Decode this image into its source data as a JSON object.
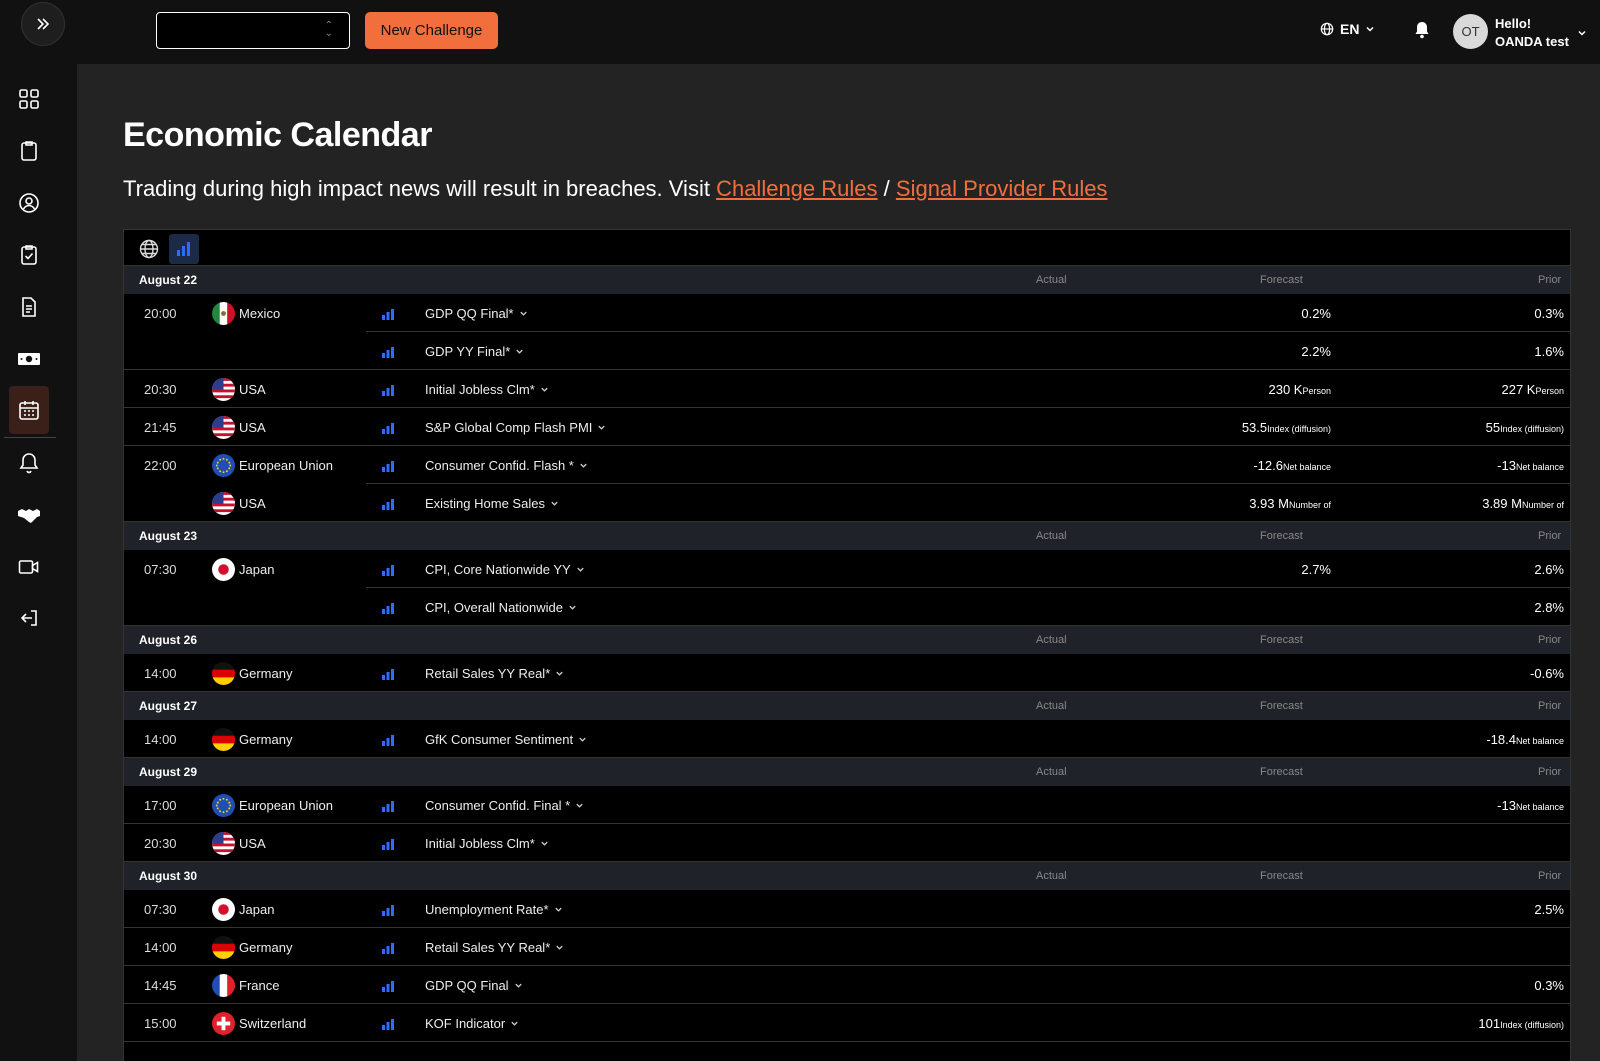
{
  "topbar": {
    "new_challenge_label": "New Challenge",
    "language": "EN",
    "avatar_initials": "OT",
    "greeting": "Hello!",
    "user_name": "OANDA test"
  },
  "page": {
    "title": "Economic Calendar",
    "notice_text": "Trading during high impact news will result in breaches. Visit",
    "link_challenge_rules": "Challenge Rules",
    "separator": "/",
    "link_signal_rules": "Signal Provider Rules"
  },
  "columns": {
    "actual": "Actual",
    "forecast": "Forecast",
    "prior": "Prior"
  },
  "colors": {
    "accent": "#f26f3d",
    "impact": "#2f6bff"
  },
  "days": [
    {
      "date": "August 22",
      "events": [
        {
          "time": "20:00",
          "country": "Mexico",
          "flag": "mx",
          "event": "GDP QQ Final*",
          "forecast": "0.2%",
          "forecast_unit": "",
          "prior": "0.3%",
          "prior_unit": ""
        },
        {
          "time": "",
          "country": "",
          "flag": "",
          "event": "GDP YY Final*",
          "forecast": "2.2%",
          "forecast_unit": "",
          "prior": "1.6%",
          "prior_unit": ""
        },
        {
          "time": "20:30",
          "country": "USA",
          "flag": "us",
          "event": "Initial Jobless Clm*",
          "forecast": "230 K",
          "forecast_unit": "Person",
          "prior": "227 K",
          "prior_unit": "Person"
        },
        {
          "time": "21:45",
          "country": "USA",
          "flag": "us",
          "event": "S&P Global Comp Flash PMI",
          "forecast": "53.5",
          "forecast_unit": "Index (diffusion)",
          "prior": "55",
          "prior_unit": "Index (diffusion)"
        },
        {
          "time": "22:00",
          "country": "European Union",
          "flag": "eu",
          "event": "Consumer Confid. Flash *",
          "forecast": "-12.6",
          "forecast_unit": "Net balance",
          "prior": "-13",
          "prior_unit": "Net balance"
        },
        {
          "time": "",
          "country": "USA",
          "flag": "us",
          "event": "Existing Home Sales",
          "forecast": "3.93 M",
          "forecast_unit": "Number of",
          "prior": "3.89 M",
          "prior_unit": "Number of"
        }
      ]
    },
    {
      "date": "August 23",
      "events": [
        {
          "time": "07:30",
          "country": "Japan",
          "flag": "jp",
          "event": "CPI, Core Nationwide YY",
          "forecast": "2.7%",
          "forecast_unit": "",
          "prior": "2.6%",
          "prior_unit": ""
        },
        {
          "time": "",
          "country": "",
          "flag": "",
          "event": "CPI, Overall Nationwide",
          "forecast": "",
          "forecast_unit": "",
          "prior": "2.8%",
          "prior_unit": ""
        }
      ]
    },
    {
      "date": "August 26",
      "events": [
        {
          "time": "14:00",
          "country": "Germany",
          "flag": "de",
          "event": "Retail Sales YY Real*",
          "forecast": "",
          "forecast_unit": "",
          "prior": "-0.6%",
          "prior_unit": ""
        }
      ]
    },
    {
      "date": "August 27",
      "events": [
        {
          "time": "14:00",
          "country": "Germany",
          "flag": "de",
          "event": "GfK Consumer Sentiment",
          "forecast": "",
          "forecast_unit": "",
          "prior": "-18.4",
          "prior_unit": "Net balance"
        }
      ]
    },
    {
      "date": "August 29",
      "events": [
        {
          "time": "17:00",
          "country": "European Union",
          "flag": "eu",
          "event": "Consumer Confid. Final *",
          "forecast": "",
          "forecast_unit": "",
          "prior": "-13",
          "prior_unit": "Net balance"
        },
        {
          "time": "20:30",
          "country": "USA",
          "flag": "us",
          "event": "Initial Jobless Clm*",
          "forecast": "",
          "forecast_unit": "",
          "prior": "",
          "prior_unit": ""
        }
      ]
    },
    {
      "date": "August 30",
      "events": [
        {
          "time": "07:30",
          "country": "Japan",
          "flag": "jp",
          "event": "Unemployment Rate*",
          "forecast": "",
          "forecast_unit": "",
          "prior": "2.5%",
          "prior_unit": ""
        },
        {
          "time": "14:00",
          "country": "Germany",
          "flag": "de",
          "event": "Retail Sales YY Real*",
          "forecast": "",
          "forecast_unit": "",
          "prior": "",
          "prior_unit": ""
        },
        {
          "time": "14:45",
          "country": "France",
          "flag": "fr",
          "event": "GDP QQ Final",
          "forecast": "",
          "forecast_unit": "",
          "prior": "0.3%",
          "prior_unit": ""
        },
        {
          "time": "15:00",
          "country": "Switzerland",
          "flag": "ch",
          "event": "KOF Indicator",
          "forecast": "",
          "forecast_unit": "",
          "prior": "101",
          "prior_unit": "Index (diffusion)"
        }
      ]
    }
  ]
}
